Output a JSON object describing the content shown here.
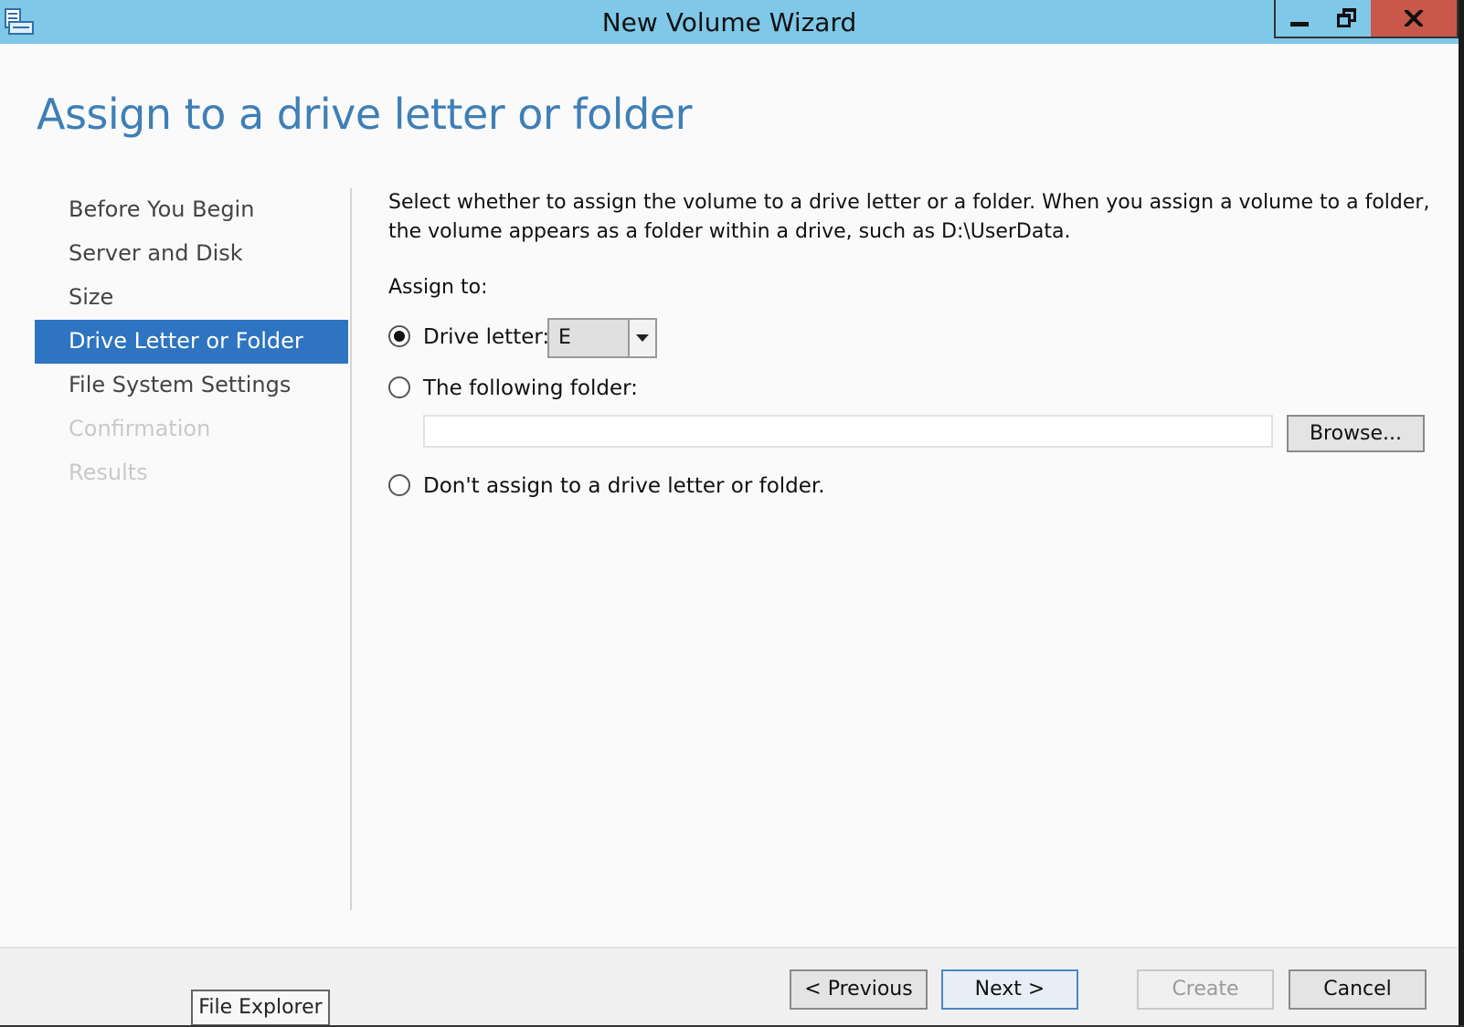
{
  "window": {
    "title": "New Volume Wizard",
    "icon": "volume-wizard-icon"
  },
  "page": {
    "heading": "Assign to a drive letter or folder"
  },
  "nav": {
    "items": [
      {
        "label": "Before You Begin",
        "state": "normal"
      },
      {
        "label": "Server and Disk",
        "state": "normal"
      },
      {
        "label": "Size",
        "state": "normal"
      },
      {
        "label": "Drive Letter or Folder",
        "state": "active"
      },
      {
        "label": "File System Settings",
        "state": "normal"
      },
      {
        "label": "Confirmation",
        "state": "disabled"
      },
      {
        "label": "Results",
        "state": "disabled"
      }
    ]
  },
  "content": {
    "description": "Select whether to assign the volume to a drive letter or a folder. When you assign a volume to a folder, the volume appears as a folder within a drive, such as D:\\UserData.",
    "assign_label": "Assign to:",
    "options": {
      "drive_letter_label": "Drive letter:",
      "drive_letter_value": "E",
      "folder_label": "The following folder:",
      "folder_value": "",
      "none_label": "Don't assign to a drive letter or folder."
    },
    "selected_option": "drive_letter",
    "browse_label": "Browse..."
  },
  "footer": {
    "previous_label": "< Previous",
    "next_label": "Next >",
    "create_label": "Create",
    "cancel_label": "Cancel"
  },
  "tooltip": {
    "text": "File Explorer"
  },
  "colors": {
    "titlebar": "#7fc8e8",
    "close_button": "#c9584a",
    "heading": "#3f7fb6",
    "nav_active": "#2e74c0"
  }
}
